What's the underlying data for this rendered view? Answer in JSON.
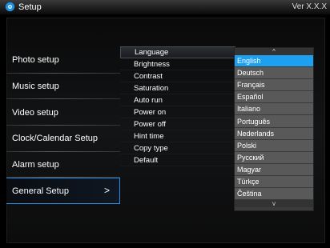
{
  "titlebar": {
    "title": "Setup",
    "version": "Ver X.X.X"
  },
  "menu": {
    "items": [
      {
        "label": "Photo setup"
      },
      {
        "label": "Music setup"
      },
      {
        "label": "Video setup"
      },
      {
        "label": "Clock/Calendar Setup"
      },
      {
        "label": "Alarm setup"
      },
      {
        "label": "General Setup",
        "active": true,
        "chevron": ">"
      }
    ]
  },
  "submenu": {
    "items": [
      "Language",
      "Brightness",
      "Contrast",
      "Saturation",
      "Auto run",
      "Power on",
      "Power off",
      "Hint time",
      "Copy type",
      "Default"
    ]
  },
  "language_list": {
    "up_arrow": "^",
    "down_arrow": "v",
    "items": [
      "English",
      "Deutsch",
      "Français",
      "Español",
      "Italiano",
      "Português",
      "Nederlands",
      "Polski",
      "Русский",
      "Magyar",
      "Türkçe",
      "Čeština"
    ],
    "selected": "English"
  },
  "colors": {
    "accent": "#1ea0f0",
    "active_border": "#2a8ad8"
  }
}
